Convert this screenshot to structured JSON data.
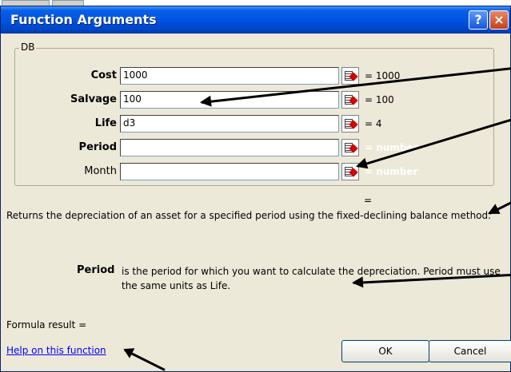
{
  "window": {
    "title": "Function Arguments",
    "help_glyph": "?",
    "close_glyph": "×"
  },
  "function_name": "DB",
  "args": [
    {
      "label": "Cost",
      "value": "1000",
      "result": "= 1000"
    },
    {
      "label": "Salvage",
      "value": "100",
      "result": "= 100"
    },
    {
      "label": "Life",
      "value": "d3",
      "result": "= 4"
    },
    {
      "label": "Period",
      "value": "",
      "result": "= number"
    },
    {
      "label": "Month",
      "value": "",
      "result": "= number"
    }
  ],
  "overall_result": "=",
  "description": "Returns the depreciation of an asset for a specified period using the fixed-declining balance method.",
  "arg_help": {
    "name": "Period",
    "text": "is the period for which you want to calculate the depreciation. Period must use the same units as Life."
  },
  "formula_result_label": "Formula result =",
  "help_link": "Help on this function",
  "buttons": {
    "ok": "OK",
    "cancel": "Cancel"
  },
  "icons": {
    "ref_picker": "collapse-dialog-icon",
    "help": "help-icon",
    "close": "close-icon"
  }
}
